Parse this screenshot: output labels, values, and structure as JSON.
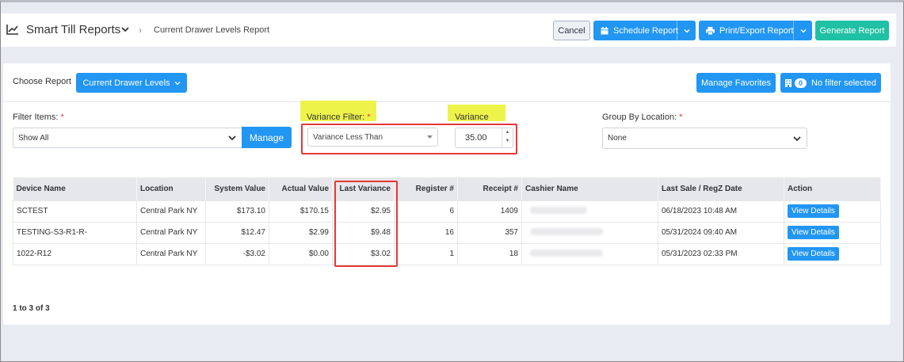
{
  "header": {
    "app_title": "Smart Till Reports",
    "breadcrumb": "Current Drawer Levels Report",
    "cancel": "Cancel",
    "schedule": "Schedule Report",
    "print_export": "Print/Export Report",
    "generate": "Generate Report"
  },
  "report": {
    "choose_label": "Choose Report",
    "selected": "Current Drawer Levels",
    "manage_favorites": "Manage Favorites",
    "filter_badge": "0",
    "filter_status": "No filter selected"
  },
  "filters": {
    "filter_items_label": "Filter Items:",
    "filter_items_value": "Show All",
    "manage": "Manage",
    "variance_filter_label": "Variance Filter:",
    "variance_filter_value": "Variance Less Than",
    "variance_label": "Variance",
    "variance_value": "35.00",
    "group_by_label": "Group By Location:",
    "group_by_value": "None",
    "required_mark": "*"
  },
  "table": {
    "columns": [
      "Device Name",
      "Location",
      "System Value",
      "Actual Value",
      "Last Variance",
      "Register #",
      "Receipt #",
      "Cashier Name",
      "Last Sale / RegZ Date",
      "Action"
    ],
    "rows": [
      {
        "device": "SCTEST",
        "location": "Central Park NY",
        "system": "$173.10",
        "actual": "$170.15",
        "variance": "$2.95",
        "register": "6",
        "receipt": "1409",
        "date": "06/18/2023 10:48 AM",
        "action": "View Details"
      },
      {
        "device": "TESTING-S3-R1-R-",
        "location": "Central Park NY",
        "system": "$12.47",
        "actual": "$2.99",
        "variance": "$9.48",
        "register": "16",
        "receipt": "357",
        "date": "05/31/2024 09:40 AM",
        "action": "View Details"
      },
      {
        "device": "1022-R12",
        "location": "Central Park NY",
        "system": "-$3.02",
        "actual": "$0.00",
        "variance": "$3.02",
        "register": "1",
        "receipt": "18",
        "date": "05/31/2023 02:33 PM",
        "action": "View Details"
      }
    ]
  },
  "pagination": "1 to 3 of 3",
  "colors": {
    "primary": "#2196f3",
    "teal": "#1fc0a3",
    "highlight": "#eef34a",
    "annotation_red": "#e53935"
  },
  "icons": [
    "line-chart-icon",
    "chevron-down-icon",
    "chevron-right-icon",
    "calendar-icon",
    "printer-icon",
    "building-icon",
    "spinner-arrows-icon"
  ]
}
